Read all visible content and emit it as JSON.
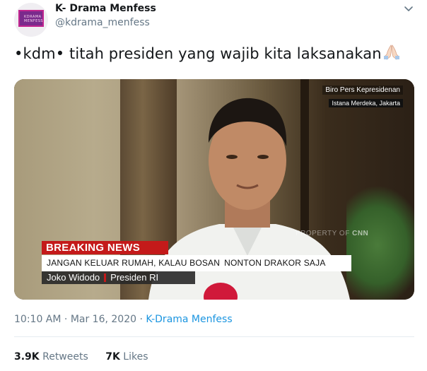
{
  "account": {
    "display_name": "K- Drama Menfess",
    "handle": "@kdrama_menfess",
    "avatar_logo_text": "KDRAMA MENFESS"
  },
  "tweet": {
    "text": "•kdm• titah presiden yang wajib kita laksanakan",
    "emoji_icon": "folded-hands-icon"
  },
  "media": {
    "credit_line1": "Biro Pers Kepresidenan",
    "credit_line2": "Istana Merdeka, Jakarta",
    "watermark_text": "PROPERTY OF",
    "watermark_brand": "CNN",
    "breaking_label": "BREAKING NEWS",
    "headline_part1": "JANGAN KELUAR RUMAH, KALAU BOSAN",
    "headline_part2": "NONTON DRAKOR SAJA",
    "name": "Joko Widodo",
    "title": "Presiden RI"
  },
  "meta": {
    "time": "10:10 AM",
    "dot1": "·",
    "date": "Mar 16, 2020",
    "dot2": "·",
    "source": "K-Drama Menfess"
  },
  "stats": {
    "retweets_count": "3.9K",
    "retweets_label": "Retweets",
    "likes_count": "7K",
    "likes_label": "Likes"
  },
  "colors": {
    "link": "#1b95e0",
    "muted": "#657786",
    "breaking_red": "#c41a1a"
  }
}
